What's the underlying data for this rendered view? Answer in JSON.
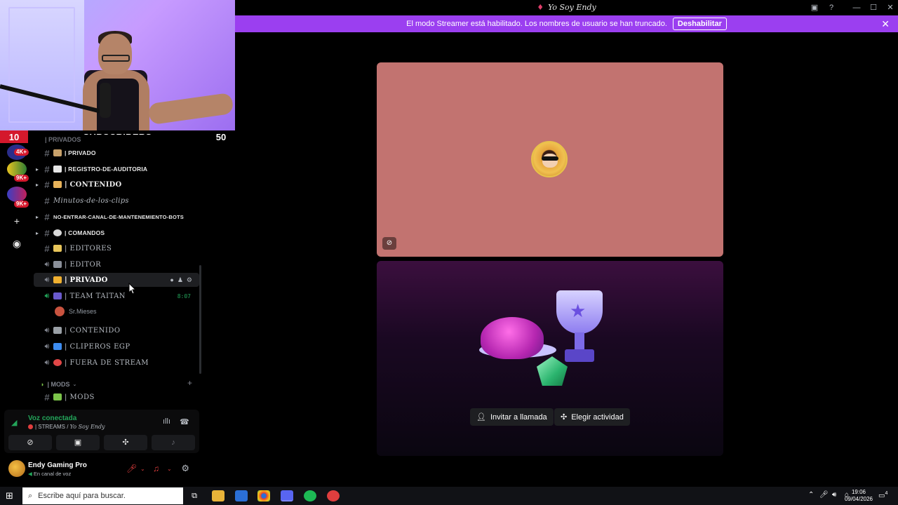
{
  "window": {
    "title": "Yo Soy Endy"
  },
  "overlay": {
    "left_count": "10",
    "label": "SUBSCRIBERS",
    "right_count": "50"
  },
  "banner": {
    "message": "El modo Streamer está habilitado. Los nombres de usuario se han truncado.",
    "button": "Deshabilitar"
  },
  "rail": {
    "badges": [
      "4K+",
      "9K+",
      "9K+"
    ]
  },
  "channels": {
    "top_category": "| PRIVADOS",
    "items": [
      {
        "name": "| PRIVADO"
      },
      {
        "name": "| REGISTRO-DE-AUDITORIA"
      },
      {
        "name": "| CONTENIDO"
      },
      {
        "name": "Minutos-de-los-clips"
      },
      {
        "name": "NO-ENTRAR-CANAL-DE-MANTENEMIENTO-BOTS"
      },
      {
        "name": "| COMANDOS"
      },
      {
        "name": "| EDITORES"
      },
      {
        "name": "| EDITOR"
      },
      {
        "name": "| PRIVADO"
      },
      {
        "name": "| TEAM TAITAN",
        "timer": "8:07"
      },
      {
        "name": "| CONTENIDO"
      },
      {
        "name": "| CLIPEROS EGP"
      },
      {
        "name": "| FUERA DE STREAM"
      },
      {
        "name": "| MODS"
      }
    ],
    "member": "Sr.Mieses",
    "mods_category": "| MODS"
  },
  "voice": {
    "status": "Voz conectada",
    "channel": "| STREAMS / ",
    "server": "Yo Soy Endy"
  },
  "user": {
    "name": "Endy Gaming Pro",
    "status": "En canal de voz"
  },
  "stage": {
    "invite_label": "Invitar a llamada",
    "activity_label": "Elegir actividad"
  },
  "taskbar": {
    "search_placeholder": "Escribe aquí para buscar.",
    "time": "19:06",
    "date": "09/04/2026",
    "notif_count": "4"
  },
  "colors": {
    "banner": "#9b3ff0",
    "voice_green": "#23a55a",
    "tile_pink": "#c27370"
  }
}
